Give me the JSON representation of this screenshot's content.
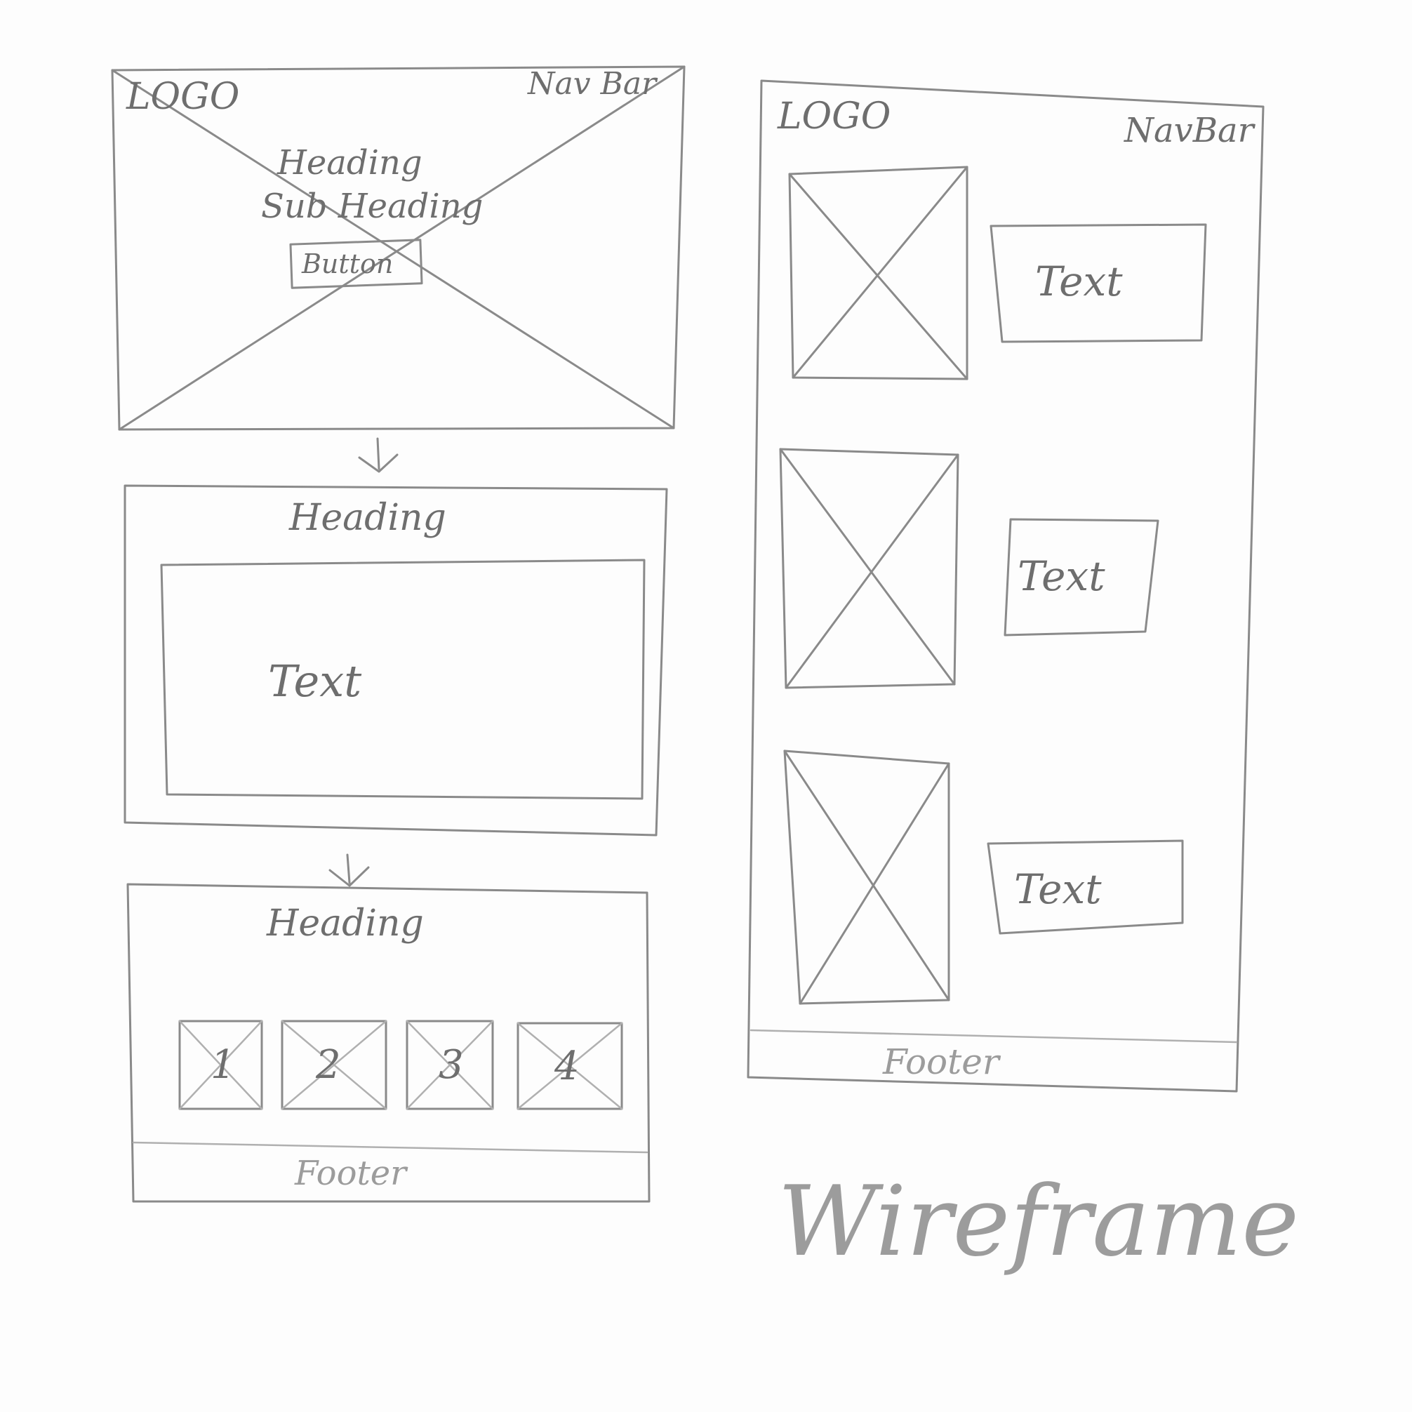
{
  "left_wireframe": {
    "hero": {
      "logo": "LOGO",
      "nav": "Nav Bar",
      "heading": "Heading",
      "subheading": "Sub Heading",
      "button": "Button"
    },
    "section2": {
      "heading": "Heading",
      "text": "Text"
    },
    "section3": {
      "heading": "Heading",
      "thumbs": [
        "1",
        "2",
        "3",
        "4"
      ],
      "footer": "Footer"
    }
  },
  "right_wireframe": {
    "logo": "LOGO",
    "nav": "NavBar",
    "rows": [
      {
        "text": "Text"
      },
      {
        "text": "Text"
      },
      {
        "text": "Text"
      }
    ],
    "footer": "Footer"
  },
  "caption": "Wireframe",
  "colors": {
    "pencil": "#8a8a8a",
    "paper": "#fdfdfd"
  }
}
